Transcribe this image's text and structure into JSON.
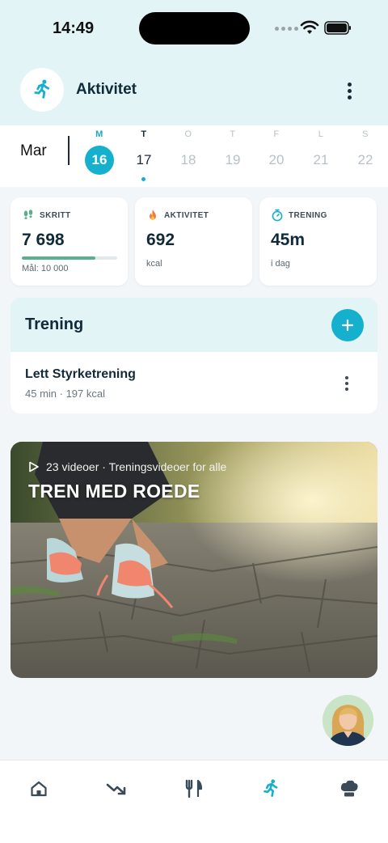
{
  "status_bar": {
    "time": "14:49"
  },
  "header": {
    "title": "Aktivitet"
  },
  "calendar": {
    "month": "Mar",
    "days": [
      {
        "dow": "M",
        "num": "16",
        "state": "selected"
      },
      {
        "dow": "T",
        "num": "17",
        "state": "today"
      },
      {
        "dow": "O",
        "num": "18",
        "state": "future"
      },
      {
        "dow": "T",
        "num": "19",
        "state": "future"
      },
      {
        "dow": "F",
        "num": "20",
        "state": "future"
      },
      {
        "dow": "L",
        "num": "21",
        "state": "future"
      },
      {
        "dow": "S",
        "num": "22",
        "state": "future"
      }
    ]
  },
  "stats": {
    "steps": {
      "label": "SKRITT",
      "value": "7 698",
      "goal": "Mål: 10 000",
      "progress": 0.77
    },
    "activity": {
      "label": "AKTIVITET",
      "value": "692",
      "unit": "kcal"
    },
    "training": {
      "label": "TRENING",
      "value": "45m",
      "sub": "i dag"
    }
  },
  "trening": {
    "title": "Trening",
    "workout": {
      "name": "Lett Styrketrening",
      "meta": "45 min · 197 kcal"
    }
  },
  "video_banner": {
    "meta": "23 videoer · Treningsvideoer for alle",
    "title": "TREN MED ROEDE"
  },
  "colors": {
    "accent": "#16b0cf",
    "header_bg": "#e3f4f7",
    "progress": "#5cae8e"
  },
  "nav": {
    "items": [
      "home-icon",
      "trend-down-icon",
      "fork-knife-icon",
      "running-icon",
      "chef-hat-icon"
    ],
    "active": "running-icon"
  }
}
